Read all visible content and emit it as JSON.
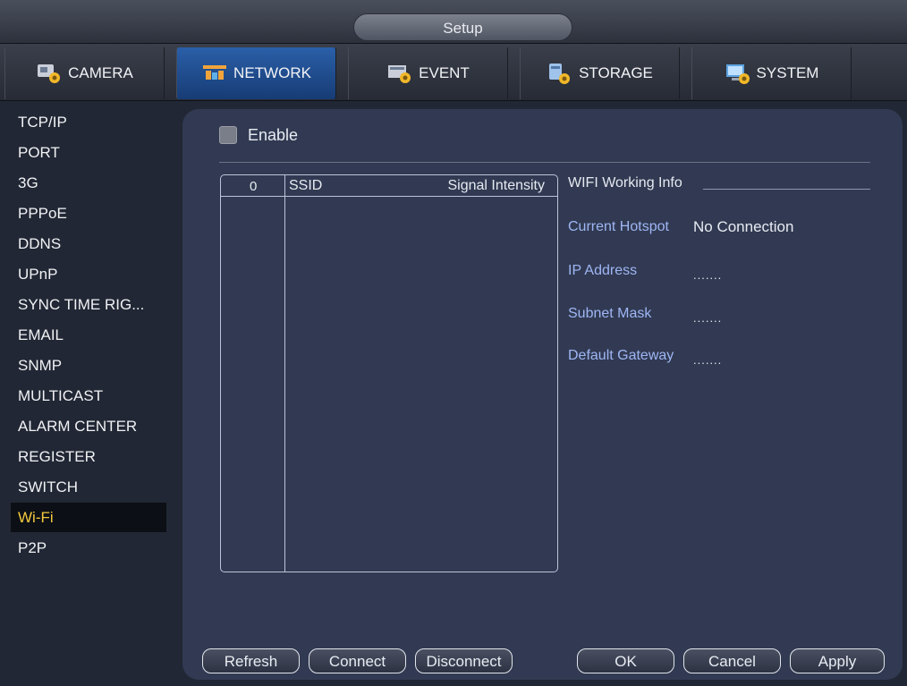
{
  "window": {
    "title": "Setup"
  },
  "tabs": [
    {
      "label": "CAMERA",
      "icon": "camera-settings-icon",
      "active": false
    },
    {
      "label": "NETWORK",
      "icon": "network-icon",
      "active": true
    },
    {
      "label": "EVENT",
      "icon": "event-icon",
      "active": false
    },
    {
      "label": "STORAGE",
      "icon": "storage-icon",
      "active": false
    },
    {
      "label": "SYSTEM",
      "icon": "system-icon",
      "active": false
    }
  ],
  "sidebar": {
    "items": [
      {
        "label": "TCP/IP"
      },
      {
        "label": "PORT"
      },
      {
        "label": "3G"
      },
      {
        "label": "PPPoE"
      },
      {
        "label": "DDNS"
      },
      {
        "label": "UPnP"
      },
      {
        "label": "SYNC TIME RIG..."
      },
      {
        "label": "EMAIL"
      },
      {
        "label": "SNMP"
      },
      {
        "label": "MULTICAST"
      },
      {
        "label": "ALARM CENTER"
      },
      {
        "label": "REGISTER"
      },
      {
        "label": "SWITCH"
      },
      {
        "label": "Wi-Fi"
      },
      {
        "label": "P2P"
      }
    ],
    "active_index": 13
  },
  "wifi": {
    "enable_label": "Enable",
    "enabled": false,
    "list": {
      "count_header": "0",
      "ssid_header": "SSID",
      "signal_header": "Signal Intensity",
      "rows": []
    },
    "info": {
      "title": "WIFI Working Info",
      "current_hotspot_label": "Current Hotspot",
      "current_hotspot_value": "No Connection",
      "ip_address_label": "IP Address",
      "ip_address_value": ".......",
      "subnet_mask_label": "Subnet Mask",
      "subnet_mask_value": ".......",
      "default_gateway_label": "Default Gateway",
      "default_gateway_value": "......."
    }
  },
  "buttons": {
    "refresh": "Refresh",
    "connect": "Connect",
    "disconnect": "Disconnect",
    "ok": "OK",
    "cancel": "Cancel",
    "apply": "Apply"
  },
  "colors": {
    "active_tab": "#2a5fa8",
    "active_sidebar_text": "#f3c93f",
    "info_label": "#9fb6f5",
    "panel": "#313a52"
  }
}
